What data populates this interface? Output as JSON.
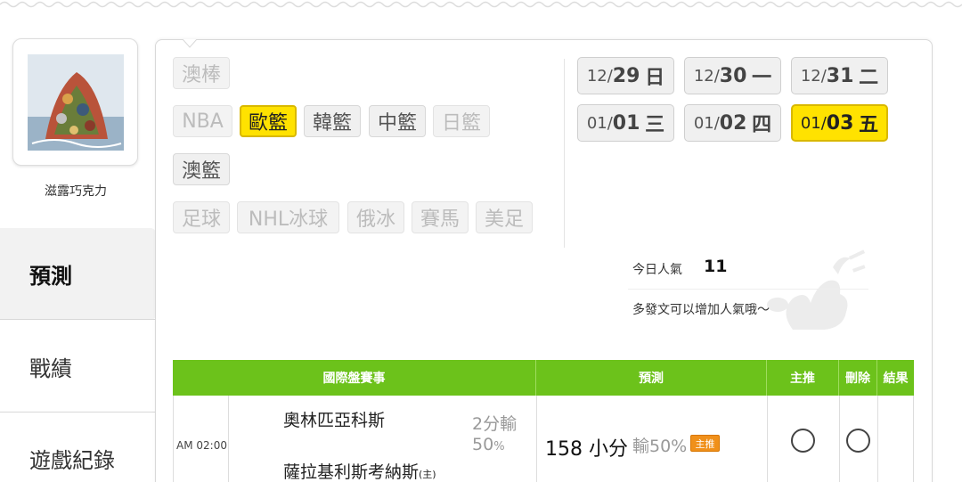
{
  "user": {
    "name": "滋露巧克力"
  },
  "nav": [
    {
      "label": "預測",
      "active": true
    },
    {
      "label": "戰績",
      "active": false
    },
    {
      "label": "遊戲紀錄",
      "active": false
    }
  ],
  "categories": {
    "row1": [
      {
        "label": "澳棒",
        "state": "dim"
      }
    ],
    "row2": [
      {
        "label": "NBA",
        "state": "dim"
      },
      {
        "label": "歐籃",
        "state": "active"
      },
      {
        "label": "韓籃",
        "state": "normal"
      },
      {
        "label": "中籃",
        "state": "normal"
      },
      {
        "label": "日籃",
        "state": "dim"
      }
    ],
    "row3": [
      {
        "label": "澳籃",
        "state": "normal"
      }
    ],
    "row4": [
      {
        "label": "足球",
        "state": "dim"
      },
      {
        "label": "NHL冰球",
        "state": "dim"
      },
      {
        "label": "俄冰",
        "state": "dim"
      },
      {
        "label": "賽馬",
        "state": "dim"
      },
      {
        "label": "美足",
        "state": "dim"
      }
    ]
  },
  "dates": [
    {
      "month": "12/",
      "day": "29",
      "weekday": "日",
      "active": false
    },
    {
      "month": "12/",
      "day": "30",
      "weekday": "一",
      "active": false
    },
    {
      "month": "12/",
      "day": "31",
      "weekday": "二",
      "active": false
    },
    {
      "month": "01/",
      "day": "01",
      "weekday": "三",
      "active": false
    },
    {
      "month": "01/",
      "day": "02",
      "weekday": "四",
      "active": false
    },
    {
      "month": "01/",
      "day": "03",
      "weekday": "五",
      "active": true
    }
  ],
  "popularity": {
    "label": "今日人氣",
    "count": "11",
    "hint": "多發文可以增加人氣哦～"
  },
  "table": {
    "headers": {
      "match": "國際盤賽事",
      "predict": "預測",
      "main": "主推",
      "delete": "刪除",
      "result": "結果"
    },
    "rows": [
      {
        "time": "AM 02:00",
        "team1": "奧林匹亞科斯",
        "team2": "薩拉基利斯考納斯",
        "team2_mark": "(主)",
        "spread": "2分輸",
        "spread_pct": "50",
        "spread_pct_unit": "%",
        "prediction": "158 小分",
        "prediction_odds": "輸50%",
        "badge": "主推"
      }
    ]
  },
  "colors": {
    "header_green": "#6cc21b",
    "active_yellow": "#ffe200",
    "badge_orange": "#f0901a"
  }
}
